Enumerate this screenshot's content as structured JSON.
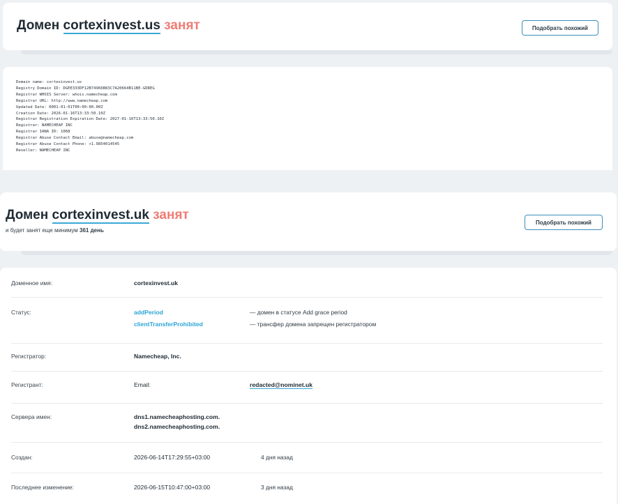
{
  "us": {
    "prefix": "Домен",
    "domain": "cortexinvest.us",
    "status": "занят",
    "button": "Подобрать похожий",
    "whois_lines": [
      "Domain name: cortexinvest.us",
      "Registry Domain ID: DGEE333DF12B74966B83C7A20664B11BE-GDREG",
      "Registrar WHOIS Server: whois.namecheap.com",
      "Registrar URL: http://www.namecheap.com",
      "Updated Date: 0001-01-01T00:00:00.00Z",
      "Creation Date: 2026-01-16T13:33:50.10Z",
      "Registrar Registration Expiration Date: 2027-01-16T13:33:50.10Z",
      "Registrar: NAMECHEAP INC",
      "Registrar IANA ID: 1068",
      "Registrar Abuse Contact Email: abuse@namecheap.com",
      "Registrar Abuse Contact Phone: +1.9854014545",
      "Reseller: NAMECHEAP INC"
    ]
  },
  "uk": {
    "prefix": "Домен",
    "domain": "cortexinvest.uk",
    "status": "занят",
    "sub_before": "и будет занят еще минимум",
    "sub_days": "361 день",
    "button": "Подобрать похожий",
    "rows": {
      "domain_name": {
        "label": "Доменное имя:",
        "value": "cortexinvest.uk"
      },
      "status": {
        "label": "Статус:",
        "items": [
          {
            "code": "addPeriod",
            "desc": "— домен в статусе Add grace period"
          },
          {
            "code": "clientTransferProhibited",
            "desc": "— трансфер домена запрещен регистратором"
          }
        ]
      },
      "registrar": {
        "label": "Регистратор:",
        "value": "Namecheap, Inc."
      },
      "registrant": {
        "label": "Регистрант:",
        "field": "Email:",
        "value": "redacted@nominet.uk"
      },
      "nameservers": {
        "label": "Сервера имен:",
        "values": [
          "dns1.namecheaphosting.com.",
          "dns2.namecheaphosting.com."
        ]
      },
      "created": {
        "label": "Создан:",
        "value": "2026-06-14T17:29:55+03:00",
        "ago": "4 дня назад"
      },
      "modified": {
        "label": "Последнее изменение:",
        "value": "2026-06-15T10:47:00+03:00",
        "ago": "3 дня назад"
      }
    }
  }
}
